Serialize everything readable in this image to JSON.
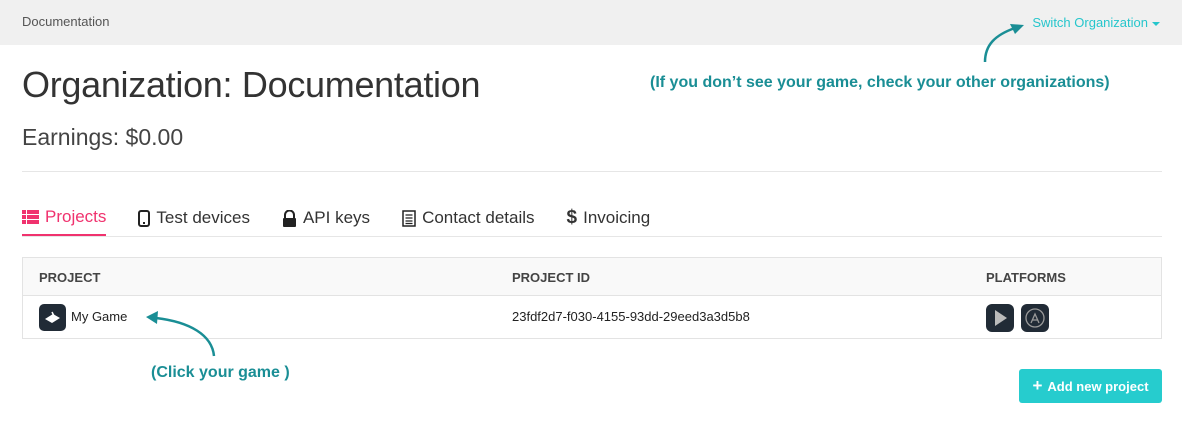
{
  "header": {
    "breadcrumb": "Documentation",
    "switch_org": "Switch Organization"
  },
  "title": "Organization: Documentation",
  "earnings": "Earnings: $0.00",
  "annotations": {
    "org_hint": "(If you don’t see your game, check your other organizations)",
    "game_hint": "(Click your game )"
  },
  "tabs": [
    {
      "label": "Projects",
      "icon": "list-icon"
    },
    {
      "label": "Test devices",
      "icon": "mobile-icon"
    },
    {
      "label": "API keys",
      "icon": "lock-icon"
    },
    {
      "label": "Contact details",
      "icon": "contact-list-icon"
    },
    {
      "label": "Invoicing",
      "icon": "dollar-icon"
    }
  ],
  "table": {
    "headers": [
      "PROJECT",
      "PROJECT ID",
      "PLATFORMS"
    ],
    "rows": [
      {
        "name": "My Game",
        "id": "23fdf2d7-f030-4155-93dd-29eed3a3d5b8",
        "platforms": [
          "google-play",
          "app-store"
        ]
      }
    ]
  },
  "add_button": "Add new project",
  "colors": {
    "accent": "#26ccce",
    "active_tab": "#f0326e",
    "annotation": "#1a8e95"
  }
}
